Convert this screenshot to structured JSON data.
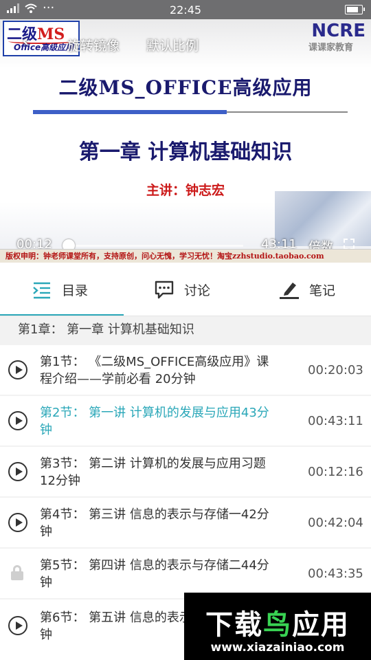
{
  "status_bar": {
    "time": "22:45"
  },
  "video": {
    "logo": {
      "line1_a": "二级",
      "line1_b": "MS",
      "line2": "Office高级应用"
    },
    "brand": {
      "name": "NCRE",
      "sub": "课课家教育"
    },
    "back_label": "‹",
    "rotate_label": "旋转镜像",
    "ratio_label": "默认比例",
    "slide": {
      "title": "二级MS_OFFICE高级应用",
      "chapter": "第一章 计算机基础知识",
      "speaker": "主讲：钟志宏"
    },
    "controls": {
      "current_time": "00:12",
      "duration": "43:11",
      "speed_label": "倍数",
      "progress": 0.005
    },
    "copyright": "版权申明：钟老师课堂所有，支持原创，问心无愧，学习无忧！淘宝zzhstudio.taobao.com"
  },
  "tabs": [
    {
      "label": "目录",
      "icon": "catalog-icon",
      "active": true
    },
    {
      "label": "讨论",
      "icon": "chat-icon",
      "active": false
    },
    {
      "label": "笔记",
      "icon": "pen-icon",
      "active": false
    }
  ],
  "accent_color": "#2aa7b8",
  "chapter": {
    "title": "第1章：  第一章 计算机基础知识"
  },
  "lessons": [
    {
      "title": "第1节：  《二级MS_OFFICE高级应用》课程介绍——学前必看 20分钟",
      "duration": "00:20:03",
      "state": "play"
    },
    {
      "title": "第2节：  第一讲 计算机的发展与应用43分钟",
      "duration": "00:43:11",
      "state": "active"
    },
    {
      "title": "第3节：  第二讲 计算机的发展与应用习题 12分钟",
      "duration": "00:12:16",
      "state": "play"
    },
    {
      "title": "第4节：  第三讲 信息的表示与存储一42分钟",
      "duration": "00:42:04",
      "state": "play"
    },
    {
      "title": "第5节：  第四讲 信息的表示与存储二44分钟",
      "duration": "00:43:35",
      "state": "locked"
    },
    {
      "title": "第6节：  第五讲 信息的表示与存储三33分钟",
      "duration": "",
      "state": "play"
    }
  ],
  "banner": {
    "text_a": "下载",
    "text_b": "鸟",
    "text_c": "应用",
    "url": "www.xiazainiao.com"
  }
}
